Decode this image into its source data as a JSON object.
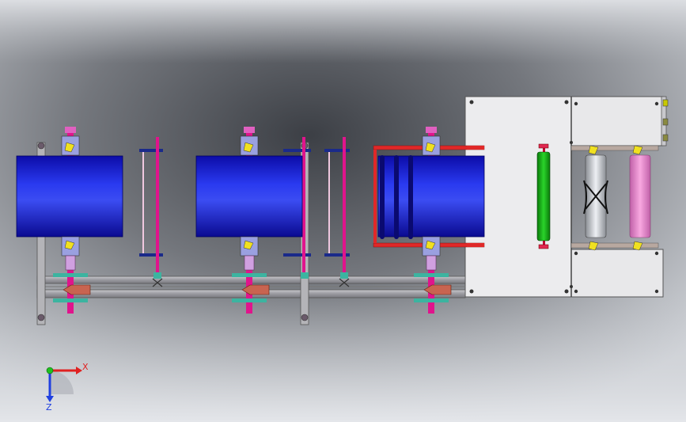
{
  "view": {
    "background_light": "#d4d7dc",
    "background_dark": "#3c3f45"
  },
  "colors": {
    "drum_blue": "#1a1adf",
    "drum_blue_light": "#3b4cf2",
    "frame_gray": "#a8a8ae",
    "frame_dark": "#6e6e74",
    "plate_light": "#e8e8ea",
    "shaft_magenta": "#e0148c",
    "roller_green": "#1ab41a",
    "roller_pink": "#f08cd2",
    "roller_silver": "#c8ccd2",
    "rail_red": "#e02828",
    "accent_yellow": "#f0e020",
    "collar_teal": "#3cb4a0",
    "bracket_copper": "#c86450"
  },
  "triad": {
    "x_label": "X",
    "z_label": "Z",
    "x_color": "#e02020",
    "y_color": "#20c020",
    "z_color": "#2040e0"
  }
}
